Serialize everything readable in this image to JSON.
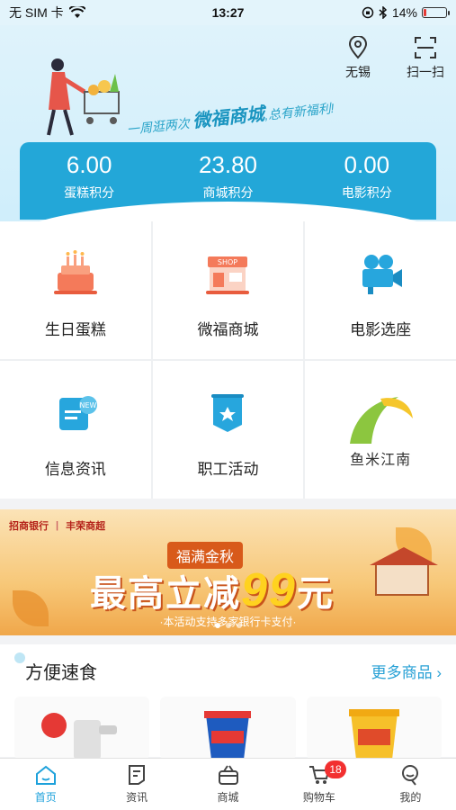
{
  "status": {
    "carrier": "无 SIM 卡",
    "time": "13:27",
    "battery": "14%",
    "battery_level": 0.14
  },
  "header": {
    "location_label": "无锡",
    "scan_label": "扫一扫",
    "slogan_prefix": "一周逛两次",
    "slogan_brand": "微福商城",
    "slogan_suffix": ",总有新福利!",
    "points": [
      {
        "value": "6.00",
        "label": "蛋糕积分"
      },
      {
        "value": "23.80",
        "label": "商城积分"
      },
      {
        "value": "0.00",
        "label": "电影积分"
      }
    ]
  },
  "grid": {
    "items": [
      {
        "label": "生日蛋糕",
        "icon": "birthday-cake-icon"
      },
      {
        "label": "微福商城",
        "icon": "shop-icon"
      },
      {
        "label": "电影选座",
        "icon": "movie-camera-icon"
      },
      {
        "label": "信息资讯",
        "icon": "news-scroll-icon"
      },
      {
        "label": "职工活动",
        "icon": "activity-banner-icon"
      },
      {
        "label": "",
        "icon": "yumi-jiangnan-logo",
        "logo_text": "鱼米江南"
      }
    ]
  },
  "banner": {
    "bank1": "招商银行",
    "bank2": "丰荣商超",
    "tag": "福满金秋",
    "headline": "最高立减",
    "amount": "99",
    "unit": "元",
    "note": "·本活动支持多家银行卡支付·"
  },
  "section": {
    "title": "方便速食",
    "more": "更多商品"
  },
  "tabbar": {
    "items": [
      {
        "label": "首页",
        "icon": "home-icon",
        "active": true
      },
      {
        "label": "资讯",
        "icon": "news-icon",
        "active": false
      },
      {
        "label": "商城",
        "icon": "basket-icon",
        "active": false
      },
      {
        "label": "购物车",
        "icon": "cart-icon",
        "active": false,
        "badge": "18"
      },
      {
        "label": "我的",
        "icon": "profile-icon",
        "active": false
      }
    ]
  },
  "colors": {
    "accent": "#1da1db",
    "points_card": "#23a7d8",
    "badge": "#f23030"
  }
}
